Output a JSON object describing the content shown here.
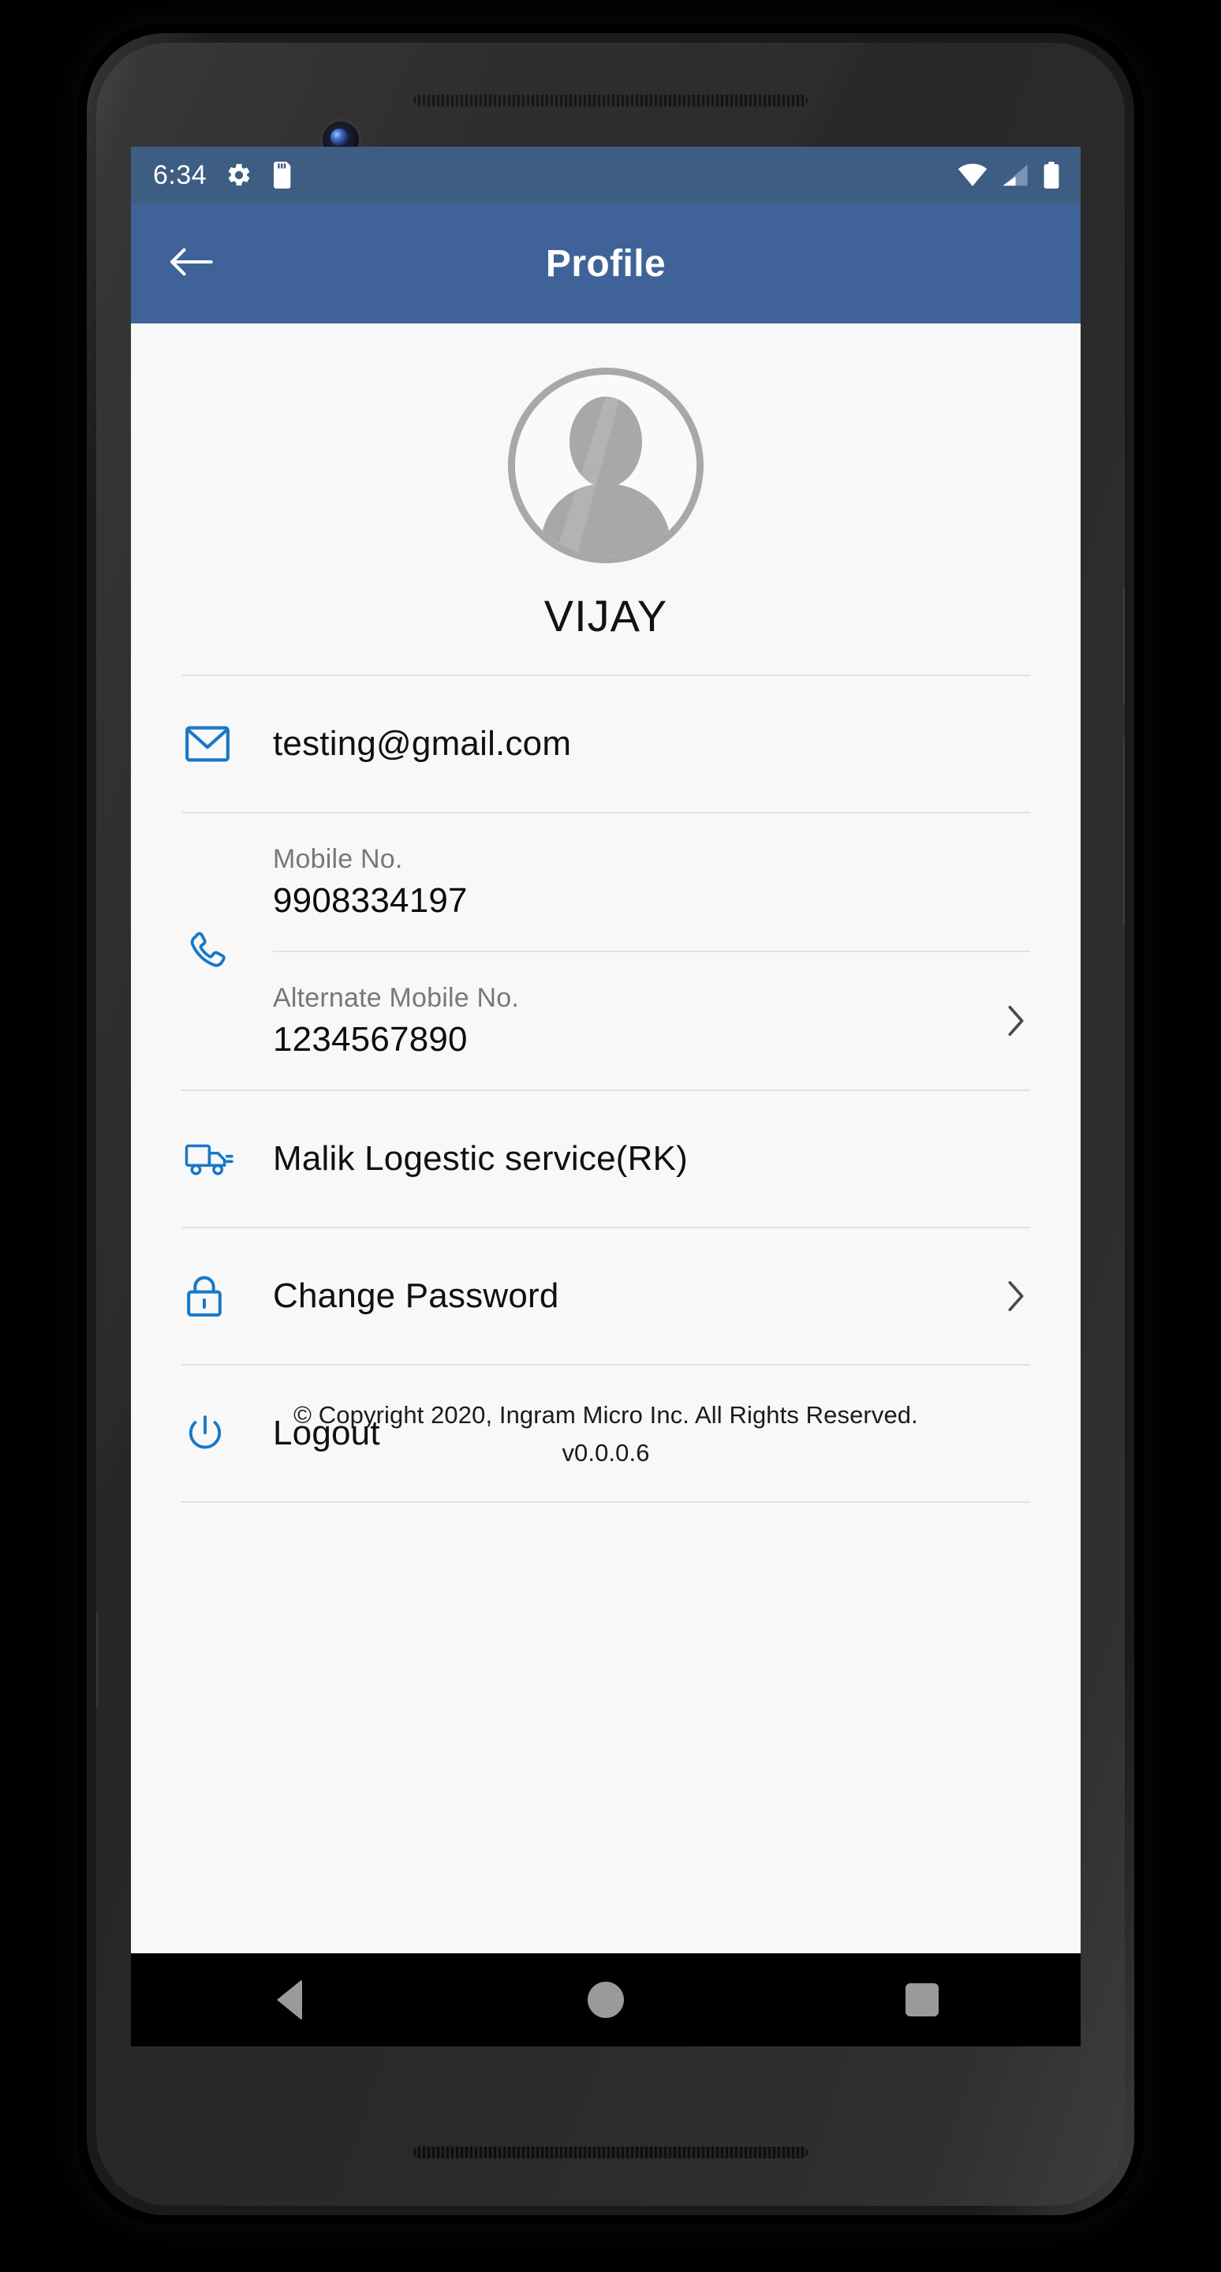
{
  "status_bar": {
    "time": "6:34",
    "icons_left": [
      "gear-icon",
      "sd-card-icon"
    ],
    "icons_right": [
      "wifi-icon",
      "cell-signal-icon",
      "battery-icon"
    ],
    "background_color": "#3d5d83"
  },
  "app_bar": {
    "title": "Profile",
    "back_icon": "arrow-left-icon",
    "background_color": "#3f6399"
  },
  "profile": {
    "avatar_icon": "user-avatar-placeholder",
    "name": "VIJAY"
  },
  "rows": {
    "email": {
      "icon": "envelope-icon",
      "value": "testing@gmail.com"
    },
    "phone": {
      "icon": "phone-icon",
      "mobile_label": "Mobile No.",
      "mobile_value": "9908334197",
      "alternate_label": "Alternate Mobile No.",
      "alternate_value": "1234567890",
      "alternate_chevron": "chevron-right-icon"
    },
    "logistics": {
      "icon": "truck-icon",
      "label": "Malik Logestic service(RK)"
    },
    "change_password": {
      "icon": "lock-icon",
      "label": "Change Password",
      "chevron": "chevron-right-icon"
    },
    "logout": {
      "icon": "power-icon",
      "label": "Logout"
    }
  },
  "footer": {
    "copyright": "© Copyright 2020, Ingram Micro Inc. All Rights Reserved.",
    "version": "v0.0.0.6"
  },
  "nav_bar": {
    "back": "nav-back-icon",
    "home": "nav-home-icon",
    "recents": "nav-recents-icon"
  },
  "colors": {
    "accent_blue": "#1878c8",
    "app_bar": "#3f6399",
    "status_bar": "#3d5d83",
    "screen_bg": "#f8f8f8",
    "divider": "#e2e2e2",
    "label_gray": "#787878"
  }
}
